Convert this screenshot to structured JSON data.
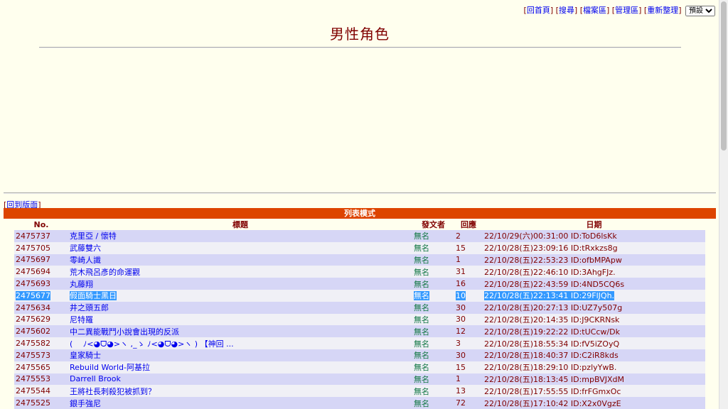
{
  "header": {
    "links": [
      {
        "label": "回首頁"
      },
      {
        "label": "搜尋"
      },
      {
        "label": "檔案區"
      },
      {
        "label": "管理區"
      },
      {
        "label": "重新整理"
      }
    ],
    "select_value": "預設",
    "title": "男性角色"
  },
  "back_link": "回到版面",
  "mode_label": "列表模式",
  "columns": {
    "no": "No.",
    "title": "標題",
    "poster": "發文者",
    "replies": "回應",
    "date": "日期"
  },
  "rows": [
    {
      "no": "2475737",
      "title": "克里亞 / 懷特",
      "poster": "無名",
      "replies": "2",
      "date": "22/10/29(六)00:31:00 ID:ToD6lsKk"
    },
    {
      "no": "2475705",
      "title": "武藤雙六",
      "poster": "無名",
      "replies": "15",
      "date": "22/10/28(五)23:09:16 ID:tRxkzs8g"
    },
    {
      "no": "2475697",
      "title": "零崎人識",
      "poster": "無名",
      "replies": "1",
      "date": "22/10/28(五)22:53:23 ID:ofbMPApw"
    },
    {
      "no": "2475694",
      "title": "荒木飛呂彥的命運觀",
      "poster": "無名",
      "replies": "31",
      "date": "22/10/28(五)22:46:10 ID:3AhgFJz."
    },
    {
      "no": "2475693",
      "title": "丸藤翔",
      "poster": "無名",
      "replies": "16",
      "date": "22/10/28(五)22:43:59 ID:4ND5CQ6s"
    },
    {
      "no": "2475677",
      "title": "假面騎士黑日",
      "poster": "無名",
      "replies": "10",
      "date": "22/10/28(五)22:13:41 ID:29FlJQh.",
      "selected": true
    },
    {
      "no": "2475634",
      "title": "井之頭五郎",
      "poster": "無名",
      "replies": "30",
      "date": "22/10/28(五)20:27:13 ID:UZ7y507g"
    },
    {
      "no": "2475629",
      "title": "尼特羅",
      "poster": "無名",
      "replies": "30",
      "date": "22/10/28(五)20:14:35 ID:J9CKRNsk"
    },
    {
      "no": "2475602",
      "title": "中二異能戰鬥小說會出現的反派",
      "poster": "無名",
      "replies": "12",
      "date": "22/10/28(五)19:22:22 ID:tUCcw/Dk"
    },
    {
      "no": "2475582",
      "title": "(　 ﾉ<◕ᗜ◕>ヽ ,_ゝ ﾉ<◕ᗜ◕>ヽ ) 【神回 ...",
      "poster": "無名",
      "replies": "3",
      "date": "22/10/28(五)18:55:34 ID:fV5iZOyQ"
    },
    {
      "no": "2475573",
      "title": "皇家騎士",
      "poster": "無名",
      "replies": "30",
      "date": "22/10/28(五)18:40:37 ID:C2iR8kds"
    },
    {
      "no": "2475565",
      "title": "Rebuild World-阿基拉",
      "poster": "無名",
      "replies": "15",
      "date": "22/10/28(五)18:29:10 ID:pzlyYwB."
    },
    {
      "no": "2475553",
      "title": "Darrell Brook",
      "poster": "無名",
      "replies": "1",
      "date": "22/10/28(五)18:13:45 ID:mpBVJXdM"
    },
    {
      "no": "2475544",
      "title": "王將社長刺殺犯被抓到？",
      "poster": "無名",
      "replies": "13",
      "date": "22/10/28(五)17:55:55 ID:frFGmxOc"
    },
    {
      "no": "2475525",
      "title": "銀手強尼",
      "poster": "無名",
      "replies": "72",
      "date": "22/10/28(五)17:10:42 ID:X2x0VgzE"
    }
  ]
}
